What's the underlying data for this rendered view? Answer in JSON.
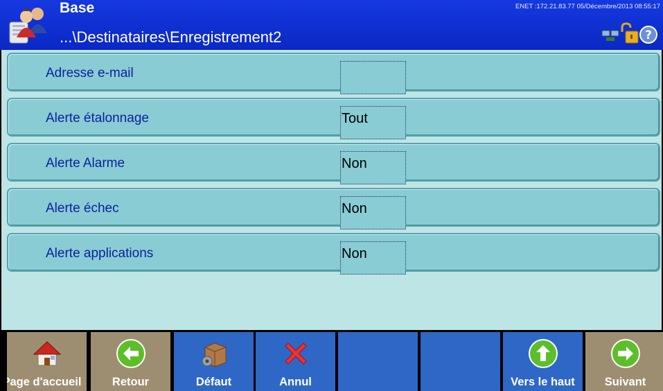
{
  "header": {
    "title": "Base",
    "path": "...\\Destinataires\\Enregistrement2",
    "status": "ENET :172.21.83.77  05/Décembre/2013 08:55:17"
  },
  "rows": [
    {
      "label": "Adresse e-mail",
      "value": ""
    },
    {
      "label": "Alerte étalonnage",
      "value": "Tout"
    },
    {
      "label": "Alerte Alarme",
      "value": "Non"
    },
    {
      "label": "Alerte échec",
      "value": "Non"
    },
    {
      "label": "Alerte applications",
      "value": "Non"
    }
  ],
  "footer": {
    "buttons": [
      {
        "label": "Page d'accueil",
        "icon": "home-icon",
        "color": "#9e8e71"
      },
      {
        "label": "Retour",
        "icon": "back-arrow-icon",
        "color": "#9e8e71"
      },
      {
        "label": "Défaut",
        "icon": "box-gear-icon",
        "color": "#2e67c6"
      },
      {
        "label": "Annul",
        "icon": "red-x-icon",
        "color": "#2e67c6"
      },
      {
        "label": "",
        "icon": "",
        "color": "#2e67c6"
      },
      {
        "label": "",
        "icon": "",
        "color": "#2e67c6"
      },
      {
        "label": "Vers le haut",
        "icon": "up-arrow-icon",
        "color": "#2e67c6"
      },
      {
        "label": "Suivant",
        "icon": "next-arrow-icon",
        "color": "#9e8e71"
      }
    ]
  },
  "colors": {
    "header_bg": "#0d2fd3",
    "content_bg": "#bde5e5",
    "row_bg": "#89ccd4",
    "row_label": "#0c1f9e",
    "button_tan": "#9e8e71",
    "button_blue": "#2e67c6"
  }
}
